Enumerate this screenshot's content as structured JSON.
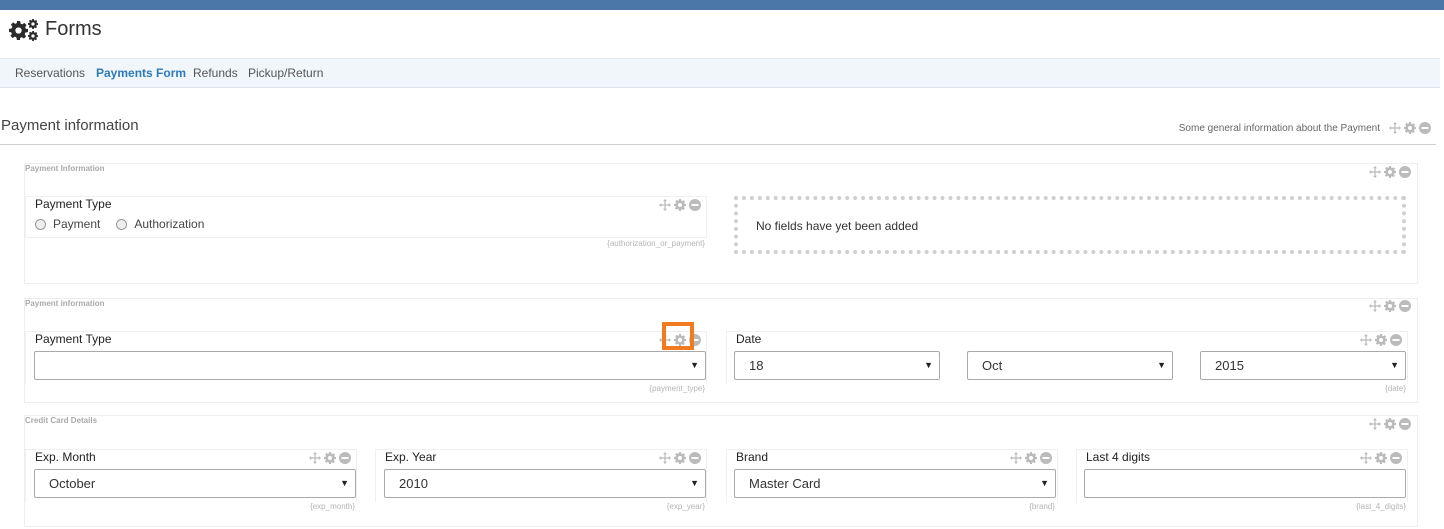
{
  "header": {
    "title": "Forms",
    "icon": "gears-icon"
  },
  "tabs": [
    {
      "label": "Reservations",
      "active": false
    },
    {
      "label": "Payments Form",
      "active": true
    },
    {
      "label": "Refunds",
      "active": false
    },
    {
      "label": "Pickup/Return",
      "active": false
    }
  ],
  "section": {
    "title": "Payment information",
    "description": "Some general information about the Payment"
  },
  "groups": [
    {
      "label": "Payment Information",
      "fields": [
        {
          "label": "Payment Type",
          "key": "{authorization_or_payment}",
          "options": [
            "Payment",
            "Authorization"
          ]
        }
      ],
      "empty_text": "No fields have yet been added"
    },
    {
      "label": "Payment information",
      "fields": [
        {
          "label": "Payment Type",
          "key": "{payment_type}",
          "value": ""
        },
        {
          "label": "Date",
          "key": "{date}",
          "day": "18",
          "month": "Oct",
          "year": "2015"
        }
      ]
    },
    {
      "label": "Credit Card Details",
      "fields": [
        {
          "label": "Exp. Month",
          "key": "{exp_month}",
          "value": "October"
        },
        {
          "label": "Exp. Year",
          "key": "{exp_year}",
          "value": "2010"
        },
        {
          "label": "Brand",
          "key": "{brand}",
          "value": "Master Card"
        },
        {
          "label": "Last 4 digits",
          "key": "{last_4_digits}",
          "value": ""
        }
      ]
    }
  ],
  "colors": {
    "accent": "#2d7ab8",
    "topbar": "#4a76a8",
    "highlight": "#f37b1f"
  }
}
